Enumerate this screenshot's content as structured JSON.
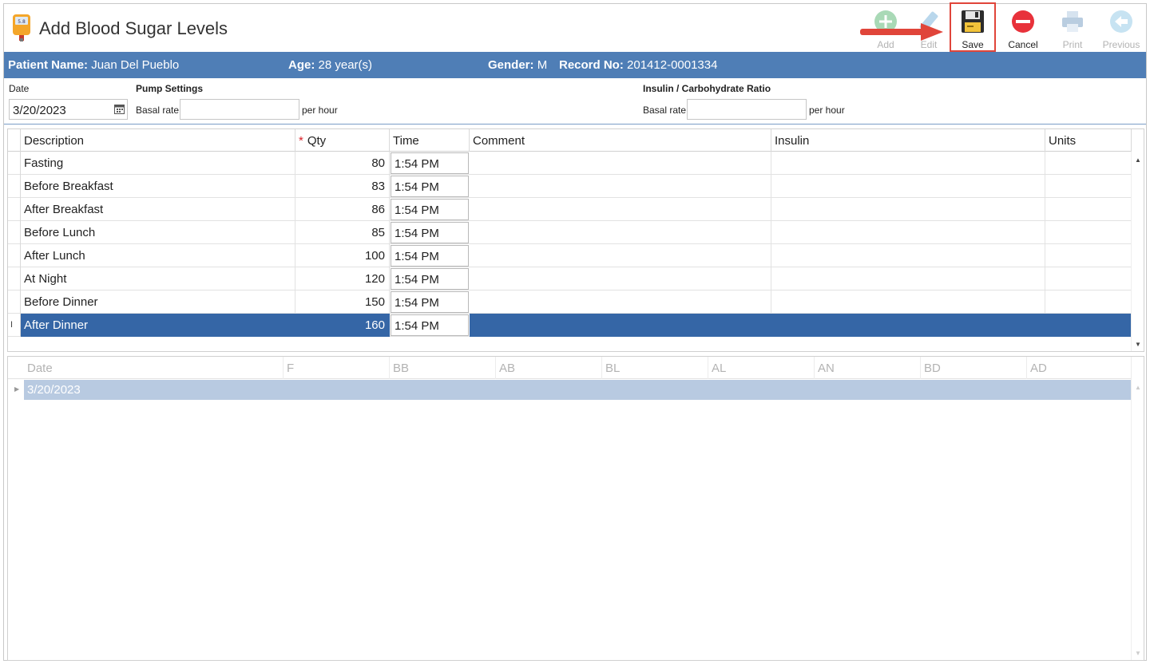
{
  "window": {
    "title": "Add Blood Sugar Levels"
  },
  "toolbar": {
    "add_label": "Add",
    "edit_label": "Edit",
    "save_label": "Save",
    "cancel_label": "Cancel",
    "print_label": "Print",
    "previous_label": "Previous"
  },
  "patient": {
    "name_label": "Patient Name:",
    "name": "Juan Del Pueblo",
    "age_label": "Age:",
    "age": "28 year(s)",
    "gender_label": "Gender:",
    "gender": "M",
    "record_label": "Record No:",
    "record": "201412-0001334"
  },
  "form": {
    "date_label": "Date",
    "date_value": "3/20/2023",
    "pump_settings_label": "Pump Settings",
    "pump_basal_label": "Basal rate",
    "pump_basal_value": "",
    "pump_unit": "per hour",
    "ratio_label": "Insulin / Carbohydrate Ratio",
    "ratio_basal_label": "Basal rate",
    "ratio_basal_value": "",
    "ratio_unit": "per hour"
  },
  "readings_grid": {
    "columns": {
      "description": "Description",
      "qty_required": "*",
      "qty": "Qty",
      "time": "Time",
      "comment": "Comment",
      "insulin": "Insulin",
      "units": "Units"
    },
    "rows": [
      {
        "description": "Fasting",
        "qty": "80",
        "time": "1:54 PM"
      },
      {
        "description": "Before Breakfast",
        "qty": "83",
        "time": "1:54 PM"
      },
      {
        "description": "After Breakfast",
        "qty": "86",
        "time": "1:54 PM"
      },
      {
        "description": "Before Lunch",
        "qty": "85",
        "time": "1:54 PM"
      },
      {
        "description": "After Lunch",
        "qty": "100",
        "time": "1:54 PM"
      },
      {
        "description": "At Night",
        "qty": "120",
        "time": "1:54 PM"
      },
      {
        "description": "Before Dinner",
        "qty": "150",
        "time": "1:54 PM"
      },
      {
        "description": "After Dinner",
        "qty": "160",
        "time": "1:54 PM"
      }
    ],
    "selected_row": 7,
    "row_indicator": "I"
  },
  "history_grid": {
    "columns": [
      "Date",
      "F",
      "BB",
      "AB",
      "BL",
      "AL",
      "AN",
      "BD",
      "AD"
    ],
    "group_row": "3/20/2023"
  },
  "colors": {
    "header_blue": "#4f7eb6",
    "selected_row": "#3566a6",
    "group_row": "#b8cae1",
    "highlight_red": "#e0453a"
  }
}
